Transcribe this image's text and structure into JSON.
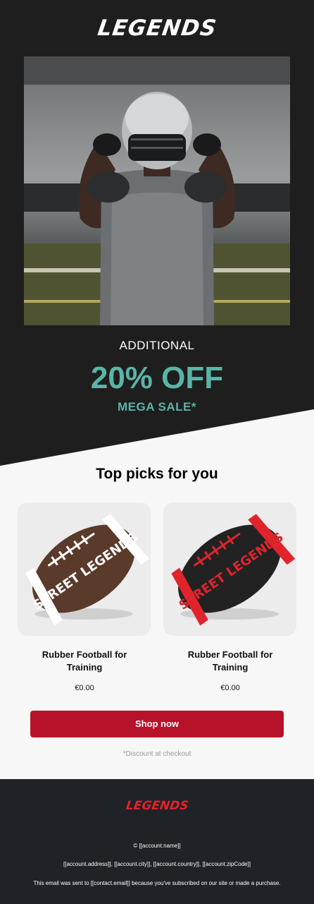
{
  "brand": {
    "logo_text": "LEGENDS"
  },
  "hero": {
    "additional_label": "ADDITIONAL",
    "discount_text": "20% OFF",
    "sale_text": "MEGA SALE*",
    "accent_color": "#5bb5a6"
  },
  "picks": {
    "title": "Top picks for you",
    "products": [
      {
        "name": "Rubber Football for Training",
        "price": "€0.00",
        "ball_color": "#5a3a2a",
        "stripe_color": "#ffffff",
        "ball_text": "STREET LEGENDS"
      },
      {
        "name": "Rubber Football for Training",
        "price": "€0.00",
        "ball_color": "#222222",
        "stripe_color": "#e0242c",
        "ball_text": "STREET LEGENDS"
      }
    ]
  },
  "cta": {
    "label": "Shop now",
    "color": "#b8122b"
  },
  "note": "*Discount at checkout",
  "footer": {
    "logo_text": "LEGENDS",
    "copyright": "© [[account.name]]",
    "address": "[[account.address]], [[account.city]], [[account.country]], [[account.zipCode]]",
    "sent_notice": "This email was sent to [[contact.email]] because you've subscribed on our site or made a purchase."
  }
}
